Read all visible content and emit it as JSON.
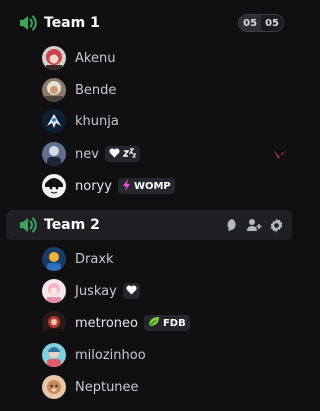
{
  "colors": {
    "accent_green": "#3ba55c",
    "background": "#101013",
    "active_row": "#1f2024",
    "valorant_red": "#e8394a"
  },
  "channels": [
    {
      "name": "Team 1",
      "icon": "voice-channel-speaker-icon",
      "user_count": "05",
      "user_limit": "05",
      "members": [
        {
          "name": "Akenu",
          "avatar": "avatar-akenu"
        },
        {
          "name": "Bende",
          "avatar": "avatar-bende"
        },
        {
          "name": "khunja",
          "avatar": "avatar-khunja"
        },
        {
          "name": "nev",
          "avatar": "avatar-nev",
          "tag_text": "",
          "tag_icons": [
            "heart-icon",
            "zzz-icon"
          ],
          "activity": "valorant-icon"
        },
        {
          "name": "noryy",
          "avatar": "avatar-noryy",
          "tag_text": "WOMP",
          "tag_icons": [
            "lightning-icon"
          ]
        }
      ]
    },
    {
      "name": "Team 2",
      "icon": "voice-channel-speaker-icon",
      "actions": [
        "chat-bubble-icon",
        "add-user-icon",
        "gear-icon"
      ],
      "members": [
        {
          "name": "Draxk",
          "avatar": "avatar-draxk"
        },
        {
          "name": "Juskay",
          "avatar": "avatar-juskay",
          "tag_icons": [
            "heart-icon"
          ]
        },
        {
          "name": "metroneo",
          "avatar": "avatar-metroneo",
          "tag_text": "FDB",
          "tag_icons": [
            "leaf-icon"
          ]
        },
        {
          "name": "milozinhoo",
          "avatar": "avatar-milozinhoo"
        },
        {
          "name": "Neptunee",
          "avatar": "avatar-neptunee"
        }
      ]
    }
  ]
}
